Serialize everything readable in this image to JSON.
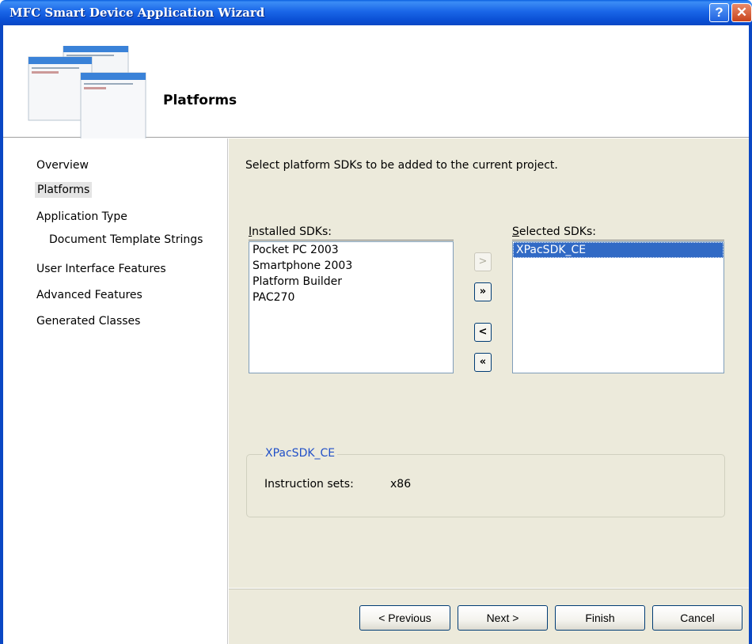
{
  "window": {
    "title": "MFC Smart Device Application Wizard",
    "help_label": "?",
    "close_label": "✕"
  },
  "header": {
    "heading": "Platforms",
    "icon": "wizard-windows-icon"
  },
  "nav": {
    "items": [
      {
        "label": "Overview"
      },
      {
        "label": "Platforms"
      },
      {
        "label": "Application Type"
      },
      {
        "label": "Document Template Strings"
      },
      {
        "label": "User Interface Features"
      },
      {
        "label": "Advanced Features"
      },
      {
        "label": "Generated Classes"
      }
    ]
  },
  "main": {
    "instruction": "Select platform SDKs to be added to the current project.",
    "installed": {
      "label_mnemonic": "I",
      "label_rest": "nstalled SDKs:",
      "items": [
        "Pocket PC 2003",
        "Smartphone 2003",
        "Platform Builder",
        "PAC270"
      ]
    },
    "selected": {
      "label_mnemonic": "S",
      "label_rest": "elected SDKs:",
      "items": [
        "XPacSDK_CE"
      ]
    },
    "buttons": {
      "add": ">",
      "add_all": "»",
      "remove": "<",
      "remove_all": "«"
    },
    "details": {
      "sdk_name": "XPacSDK_CE",
      "instruction_sets_label": "Instruction sets:",
      "instruction_sets_value": "x86"
    }
  },
  "footer": {
    "previous": "< Previous",
    "next": "Next >",
    "finish": "Finish",
    "cancel": "Cancel"
  },
  "colors": {
    "titlebar": "#0a5fe0",
    "panel": "#eceadb",
    "selection": "#316ac5",
    "legend": "#2150c8"
  }
}
